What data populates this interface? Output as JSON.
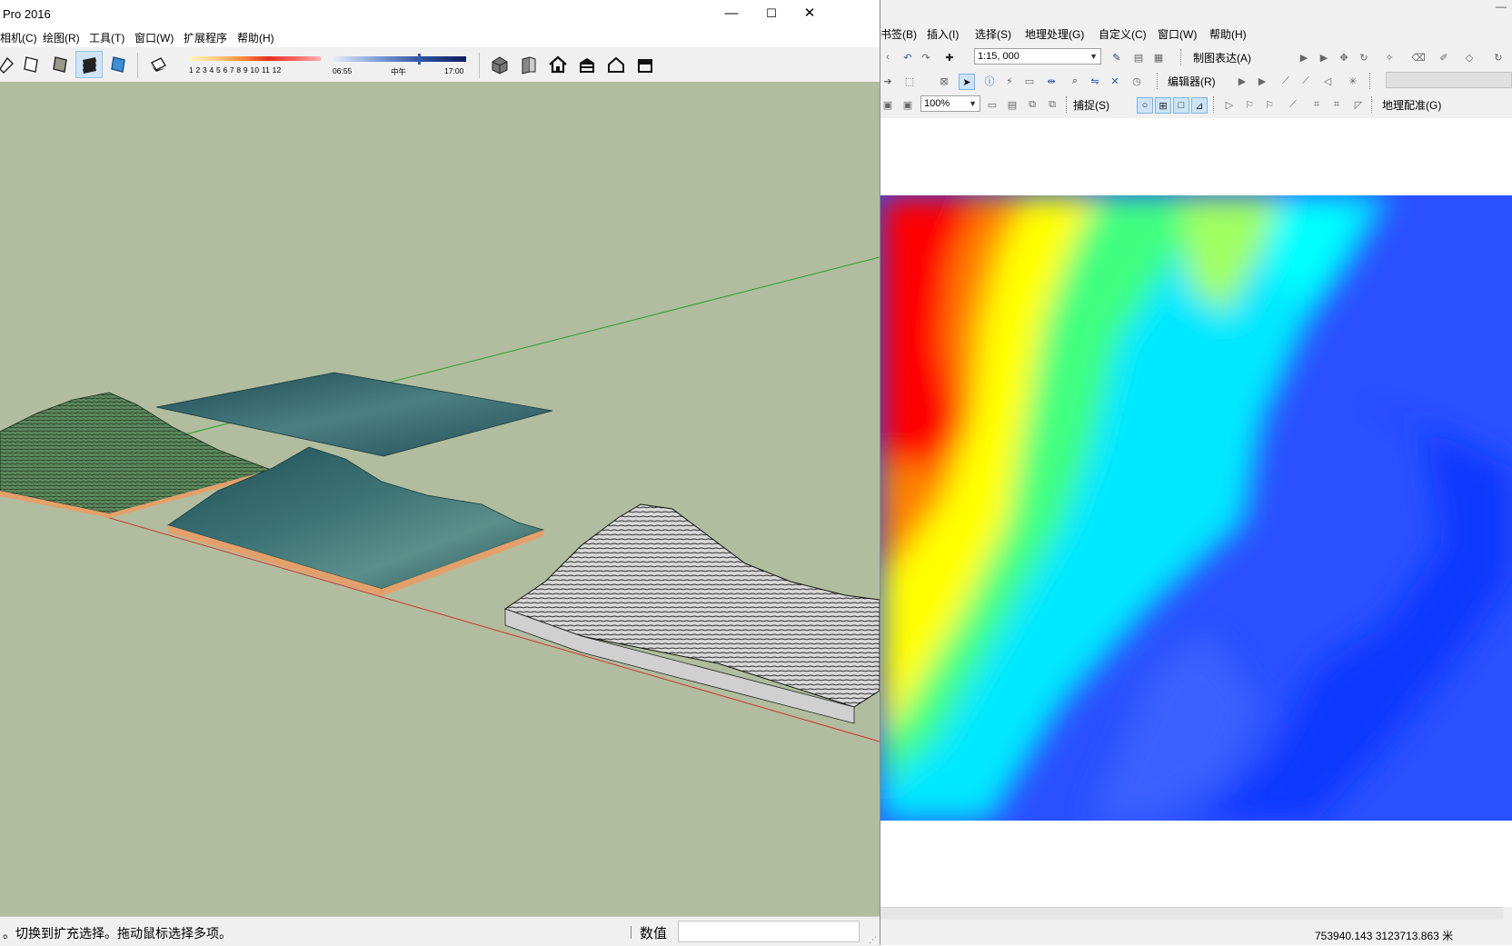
{
  "sketchup": {
    "title": "Pro 2016",
    "window_controls": {
      "minimize": "—",
      "maximize": "☐",
      "close": "✕"
    },
    "menu": [
      "相机(C)",
      "绘图(R)",
      "工具(T)",
      "窗口(W)",
      "扩展程序",
      "帮助(H)"
    ],
    "toolbar_icons": [
      "line-tool-icon",
      "face-style-icon",
      "shaded-style-icon",
      "monochrome-style-icon",
      "xray-style-icon",
      "shadows-icon",
      "warehouse-icon",
      "component-icon",
      "home-icon",
      "house-gift-icon",
      "house-outline-icon",
      "store-icon"
    ],
    "shadow_scale_numbers": "1 2 3 4 5 6 7 8 9 10 11 12",
    "time_start": "06:55",
    "time_mid": "中午",
    "time_end": "17:00",
    "time_slider_fraction": 0.64,
    "viewport_background": "#b1bd9e",
    "status_message": "。切换到扩充选择。拖动鼠标选择多项。",
    "measurements_label": "数值",
    "measurements_value": ""
  },
  "arcmap": {
    "menu": [
      "书签(B)",
      "插入(I)",
      "选择(S)",
      "地理处理(G)",
      "自定义(C)",
      "窗口(W)",
      "帮助(H)"
    ],
    "scale": "1:15, 000",
    "zoom": "100%",
    "labels": {
      "cartographic_representation": "制图表达(A)",
      "editor": "编辑器(R)",
      "snapping": "捕捉(S)",
      "georeferencing": "地理配准(G)"
    },
    "coordinates": "753940.143  3123713.863 米",
    "colors": {
      "high": "#ff0000",
      "mid_high": "#ffff00",
      "mid": "#00ffff",
      "low": "#0000ff"
    }
  }
}
